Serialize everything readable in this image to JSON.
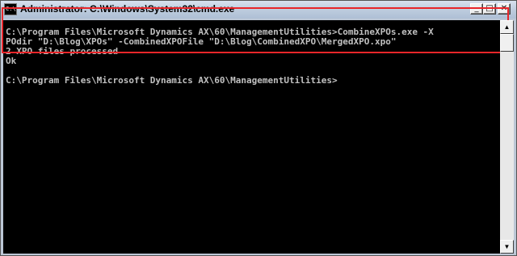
{
  "window": {
    "title": "Administrator: C:\\Windows\\System32\\cmd.exe",
    "app_icon_text": "C:\\",
    "controls": {
      "minimize": "_",
      "maximize": "□",
      "close": "✕"
    }
  },
  "console": {
    "lines": [
      "C:\\Program Files\\Microsoft Dynamics AX\\60\\ManagementUtilities>CombineXPOs.exe -X",
      "POdir \"D:\\Blog\\XPOs\" -CombinedXPOFile \"D:\\Blog\\CombinedXPO\\MergedXPO.xpo\"",
      "2 XPO files processed",
      "Ok",
      "",
      "C:\\Program Files\\Microsoft Dynamics AX\\60\\ManagementUtilities>"
    ],
    "text_color": "#c0c0c0",
    "background": "#000000"
  },
  "highlight": {
    "color": "#e8262a"
  },
  "scrollbar": {
    "up_arrow": "▲",
    "down_arrow": "▼"
  }
}
